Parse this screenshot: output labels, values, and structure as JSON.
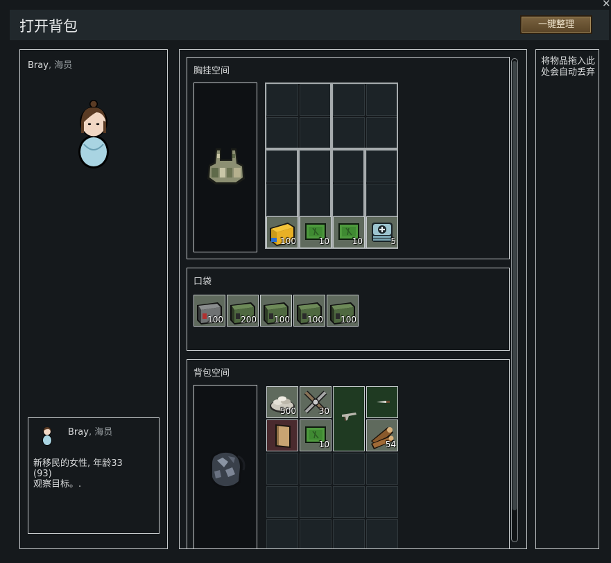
{
  "window": {
    "title": "打开背包",
    "sort_button": "一键整理",
    "close_glyph": "✕"
  },
  "pawn": {
    "name": "Bray",
    "role": ", 海员",
    "card_desc_1": "新移民的女性, 年龄33",
    "card_desc_2": "(93)",
    "card_desc_3": "观察目标。."
  },
  "sections": {
    "vest": {
      "title": "胸挂空间",
      "equipped": "chest-rig-icon"
    },
    "pockets": {
      "title": "口袋"
    },
    "backpack": {
      "title": "背包空间",
      "equipped": "backpack-icon"
    }
  },
  "vest_items": [
    {
      "icon": "ammo-box-yellow-icon",
      "qty": "100"
    },
    {
      "icon": "green-ammo-card-icon",
      "qty": "10"
    },
    {
      "icon": "green-ammo-card-icon",
      "qty": "10"
    },
    {
      "icon": "medkit-icon",
      "qty": "5"
    }
  ],
  "pocket_items": [
    {
      "icon": "red-ammo-crate-icon",
      "qty": "100"
    },
    {
      "icon": "green-ammo-crate-icon",
      "qty": "200"
    },
    {
      "icon": "green-ammo-crate-icon",
      "qty": "100"
    },
    {
      "icon": "green-ammo-crate-icon",
      "qty": "100"
    },
    {
      "icon": "green-ammo-crate-icon",
      "qty": "100"
    }
  ],
  "backpack_items": [
    {
      "icon": "silver-pile-icon",
      "qty": "500"
    },
    {
      "icon": "crossed-tools-icon",
      "qty": "30"
    },
    {
      "icon": "revolver-icon",
      "qty": ""
    },
    {
      "icon": "knife-icon",
      "qty": ""
    },
    {
      "icon": "book-icon",
      "qty": ""
    },
    {
      "icon": "green-ammo-card-icon",
      "qty": "10"
    },
    {
      "icon": "wood-logs-icon",
      "qty": "54"
    }
  ],
  "drop_zone": {
    "text": "将物品拖入此处会自动丢弃"
  },
  "colors": {
    "background": "#15191c",
    "titlebar": "#21282c",
    "border": "#c8ccce",
    "button": "#6b5433",
    "item_bg": "#5f6a5d",
    "weapon_slot": "#1f3a22",
    "book_slot": "#4a2a2e",
    "knife_slot": "#1f3a22"
  }
}
